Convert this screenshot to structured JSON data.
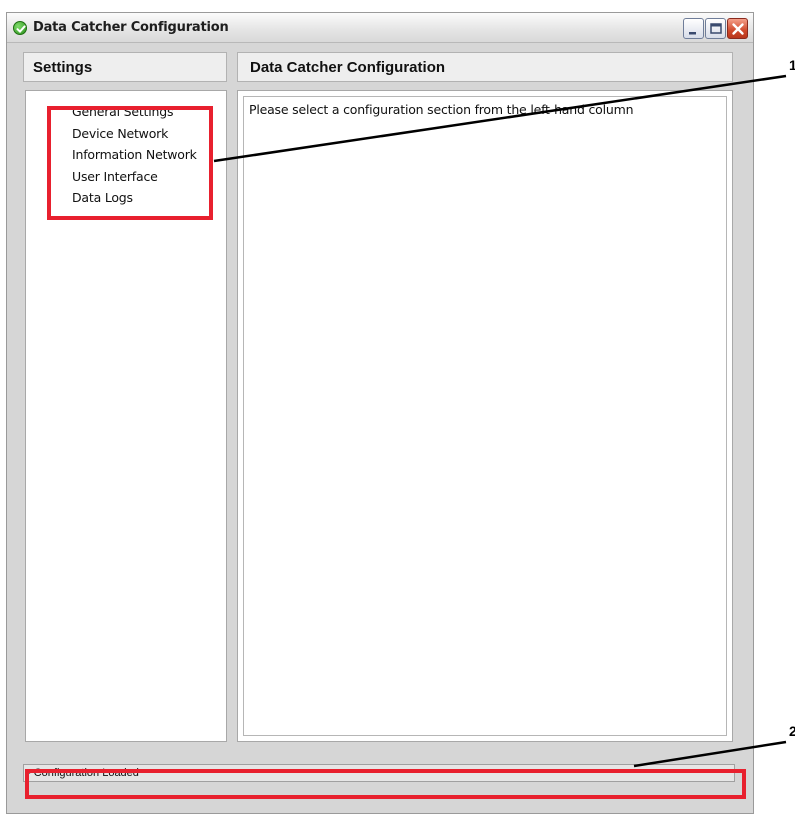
{
  "window": {
    "title": "Data Catcher Configuration",
    "icon": "green-checkmark-icon",
    "controls": [
      "minimize",
      "maximize",
      "close"
    ]
  },
  "left_panel": {
    "header": "Settings",
    "items": [
      {
        "label": "General Settings"
      },
      {
        "label": "Device Network"
      },
      {
        "label": "Information Network"
      },
      {
        "label": "User Interface"
      },
      {
        "label": "Data Logs"
      }
    ]
  },
  "right_panel": {
    "header": "Data Catcher Configuration",
    "message": "Please select a configuration section from the left-hand column"
  },
  "status_bar": {
    "text": "- Configuration Loaded"
  },
  "annotations": {
    "callout_1": "1",
    "callout_2": "2",
    "highlight_color": "#e8202e"
  }
}
